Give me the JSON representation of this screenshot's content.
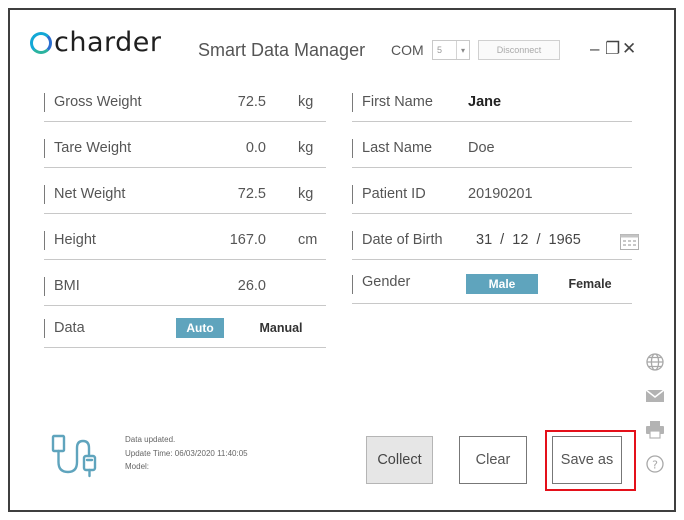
{
  "window": {
    "brand": "charder",
    "title": "Smart Data Manager",
    "com_label": "COM",
    "com_value": "5",
    "disconnect_label": "Disconnect",
    "minimize": "–",
    "restore": "❐",
    "close": "✕"
  },
  "left_fields": [
    {
      "label": "Gross Weight",
      "value": "72.5",
      "unit": "kg"
    },
    {
      "label": "Tare Weight",
      "value": "0.0",
      "unit": "kg"
    },
    {
      "label": "Net Weight",
      "value": "72.5",
      "unit": "kg"
    },
    {
      "label": "Height",
      "value": "167.0",
      "unit": "cm"
    },
    {
      "label": "BMI",
      "value": "26.0",
      "unit": ""
    }
  ],
  "data_mode": {
    "label": "Data",
    "options": [
      "Auto",
      "Manual"
    ],
    "selected": "Auto"
  },
  "right_fields": {
    "first_name": {
      "label": "First Name",
      "value": "Jane"
    },
    "last_name": {
      "label": "Last Name",
      "value": "Doe"
    },
    "patient_id": {
      "label": "Patient ID",
      "value": "20190201"
    },
    "dob": {
      "label": "Date of Birth",
      "value": "31  /  12  /  1965"
    },
    "gender": {
      "label": "Gender",
      "options": [
        "Male",
        "Female"
      ],
      "selected": "Male"
    }
  },
  "status": {
    "line1": "Data updated.",
    "line2": "Update Time: 06/03/2020 11:40:05",
    "line3": "Model:"
  },
  "buttons": {
    "collect": "Collect",
    "clear": "Clear",
    "save_as": "Save as"
  },
  "colors": {
    "accent": "#5fa4bd",
    "highlight": "#e4101a"
  },
  "icons": [
    "globe-icon",
    "mail-icon",
    "printer-icon",
    "help-icon",
    "usb-cable-icon",
    "calendar-icon"
  ]
}
